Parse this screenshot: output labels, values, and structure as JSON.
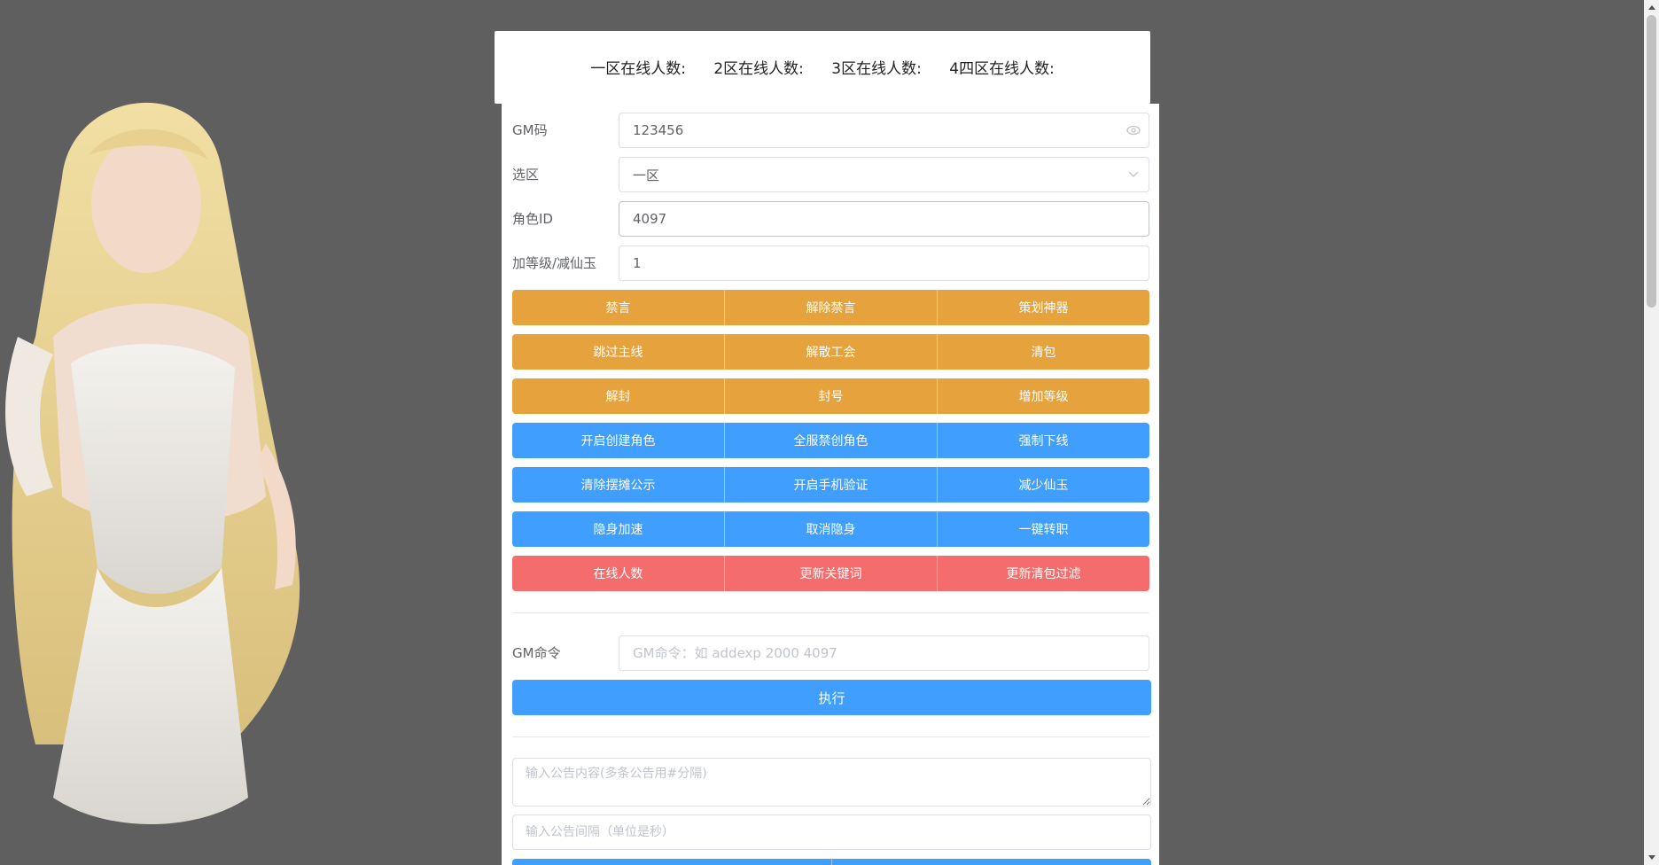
{
  "header": {
    "zones": [
      "一区在线人数:",
      "2区在线人数:",
      "3区在线人数:",
      "4四区在线人数:"
    ]
  },
  "form": {
    "gm_code": {
      "label": "GM码",
      "value": "123456"
    },
    "zone": {
      "label": "选区",
      "value": "一区"
    },
    "role_id": {
      "label": "角色ID",
      "value": "4097"
    },
    "level": {
      "label": "加等级/减仙玉",
      "value": "1"
    }
  },
  "buttons": {
    "row1": [
      "禁言",
      "解除禁言",
      "策划神器"
    ],
    "row2": [
      "跳过主线",
      "解散工会",
      "清包"
    ],
    "row3": [
      "解封",
      "封号",
      "增加等级"
    ],
    "row4": [
      "开启创建角色",
      "全服禁创角色",
      "强制下线"
    ],
    "row5": [
      "清除摆摊公示",
      "开启手机验证",
      "减少仙玉"
    ],
    "row6": [
      "隐身加速",
      "取消隐身",
      "一键转职"
    ],
    "row7": [
      "在线人数",
      "更新关键词",
      "更新清包过滤"
    ]
  },
  "gm_command": {
    "label": "GM命令",
    "placeholder": "GM命令：如 addexp 2000 4097",
    "execute_label": "执行"
  },
  "notice": {
    "content_placeholder": "输入公告内容(多条公告用#分隔)",
    "interval_placeholder": "输入公告间隔（单位是秒）"
  },
  "colors": {
    "warning": "#e6a23c",
    "primary": "#409eff",
    "danger": "#f56c6c",
    "background": "#5f5f5f"
  }
}
